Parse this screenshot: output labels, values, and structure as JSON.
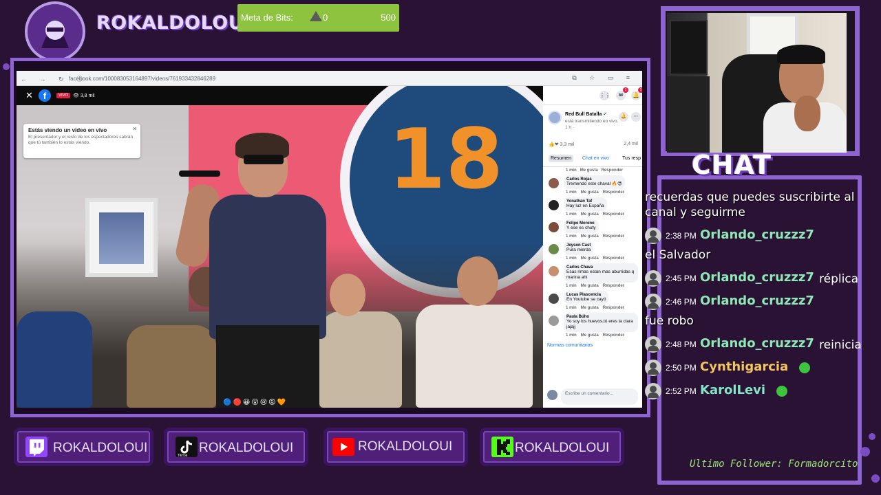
{
  "brand": {
    "name": "ROKALDOLOUI"
  },
  "bits_goal": {
    "label": "Meta de Bits:",
    "current": "0",
    "max": "500",
    "progress": 0
  },
  "browser": {
    "url": "facebook.com/100083053164897/videos/761933432846289"
  },
  "video": {
    "live_label": "VIVO",
    "viewers": "3,8 mil",
    "notice_title": "Estás viendo un video en vivo",
    "notice_desc": "El presentador y el resto de los espectadores sabrán que tú también lo estás viendo.",
    "stage_number": "18"
  },
  "fb_panel": {
    "page_name": "Red Bull Batalla",
    "status": "está transmitiendo en vivo.",
    "time": "1 h ·",
    "reactions": "3,3 mil",
    "comments_count": "2,4 mil",
    "tabs": [
      "Resumen",
      "Chat en vivo",
      "Tus resp"
    ],
    "meta_time": "1 min",
    "meta_like": "Me gusta",
    "meta_reply": "Responder",
    "comments": [
      {
        "name": "Carlos Rojas",
        "text": "Tremendo este chaval 🔥😍",
        "avatar_color": "#8a5a4a"
      },
      {
        "name": "Yonathan Taf",
        "text": "Hay luz en España",
        "avatar_color": "#222222"
      },
      {
        "name": "Felipe Moreno",
        "text": "Y ese es chuty",
        "avatar_color": "#7a4a3a"
      },
      {
        "name": "Jeyson Cast",
        "text": "Pura mierda",
        "avatar_color": "#6a8a4a"
      },
      {
        "name": "Carlos Chava",
        "text": "Esas rimas estan mas aburridas q marina ahi",
        "avatar_color": "#c49070"
      },
      {
        "name": "Lucas Plascencia",
        "text": "En Youtube se cayó",
        "avatar_color": "#4a4a4a"
      },
      {
        "name": "Paula Búho",
        "text": "Yo soy los huevos,tú eres la clara jajajj",
        "avatar_color": "#9a9a9a"
      }
    ],
    "norms_link": "Normas comunitarias",
    "write_placeholder": "Escribe un comentario..."
  },
  "chat": {
    "title": "CHAT",
    "messages": [
      {
        "type": "text",
        "text": "recuerdas que puedes suscribirte al canal y seguirme"
      },
      {
        "type": "line",
        "time": "2:38 PM",
        "user": "Orlando_cruzzz7",
        "text": ""
      },
      {
        "type": "text",
        "text": "el Salvador"
      },
      {
        "type": "line",
        "time": "2:45 PM",
        "user": "Orlando_cruzzz7",
        "text": "réplica"
      },
      {
        "type": "line",
        "time": "2:46 PM",
        "user": "Orlando_cruzzz7",
        "text": ""
      },
      {
        "type": "text",
        "text": "fue robo"
      },
      {
        "type": "line",
        "time": "2:48 PM",
        "user": "Orlando_cruzzz7",
        "text": "reinicia"
      },
      {
        "type": "line",
        "time": "2:50 PM",
        "user": "Cynthigarcia",
        "text": ""
      },
      {
        "type": "line",
        "time": "2:52 PM",
        "user": "KarolLevi",
        "text": ""
      }
    ]
  },
  "follower": {
    "text": "Ultimo Follower: Formadorcito"
  },
  "socials": [
    {
      "platform": "twitch",
      "label": "ROKALDOLOUI",
      "icon_color": "#9146ff"
    },
    {
      "platform": "tiktok",
      "label": "ROKALDOLOUI",
      "icon_color": "#111111",
      "sub": "TikTok"
    },
    {
      "platform": "youtube",
      "label": "ROKALDOLOUI",
      "icon_color": "#ff0000"
    },
    {
      "platform": "kick",
      "label": "ROKALDOLOUI",
      "icon_color": "#53fc18"
    }
  ],
  "colors": {
    "frame": "#8e63d2",
    "background": "#2a1235",
    "bits_bar": "#8ec33f",
    "chat_user": "#8ee8b4",
    "chat_user_gold": "#f3c65c"
  }
}
